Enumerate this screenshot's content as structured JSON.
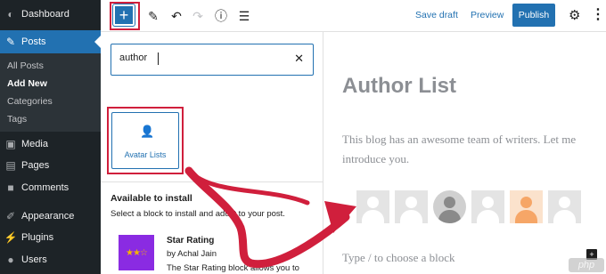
{
  "sidebar": {
    "dashboard": "Dashboard",
    "posts": "Posts",
    "submenu": [
      "All Posts",
      "Add New",
      "Categories",
      "Tags"
    ],
    "media": "Media",
    "pages": "Pages",
    "comments": "Comments",
    "appearance": "Appearance",
    "plugins": "Plugins",
    "users": "Users"
  },
  "toolbar": {
    "inserter_label": "+",
    "save_draft": "Save draft",
    "preview": "Preview",
    "publish": "Publish"
  },
  "inserter": {
    "search_value": "author",
    "block_result": "Avatar Lists",
    "install_title": "Available to install",
    "install_desc": "Select a block to install and add it to your post.",
    "plugin": {
      "name": "Star Rating",
      "author": "by Achal Jain",
      "desc": "The Star Rating block allows you to"
    }
  },
  "editor": {
    "title": "Author List",
    "paragraph": "This blog has an awesome team of writers. Let me introduce you.",
    "placeholder": "Type / to choose a block"
  },
  "colors": {
    "accent": "#2271b1",
    "highlight": "#d01f3c",
    "admin_bg": "#1d2327"
  },
  "watermark": "php"
}
